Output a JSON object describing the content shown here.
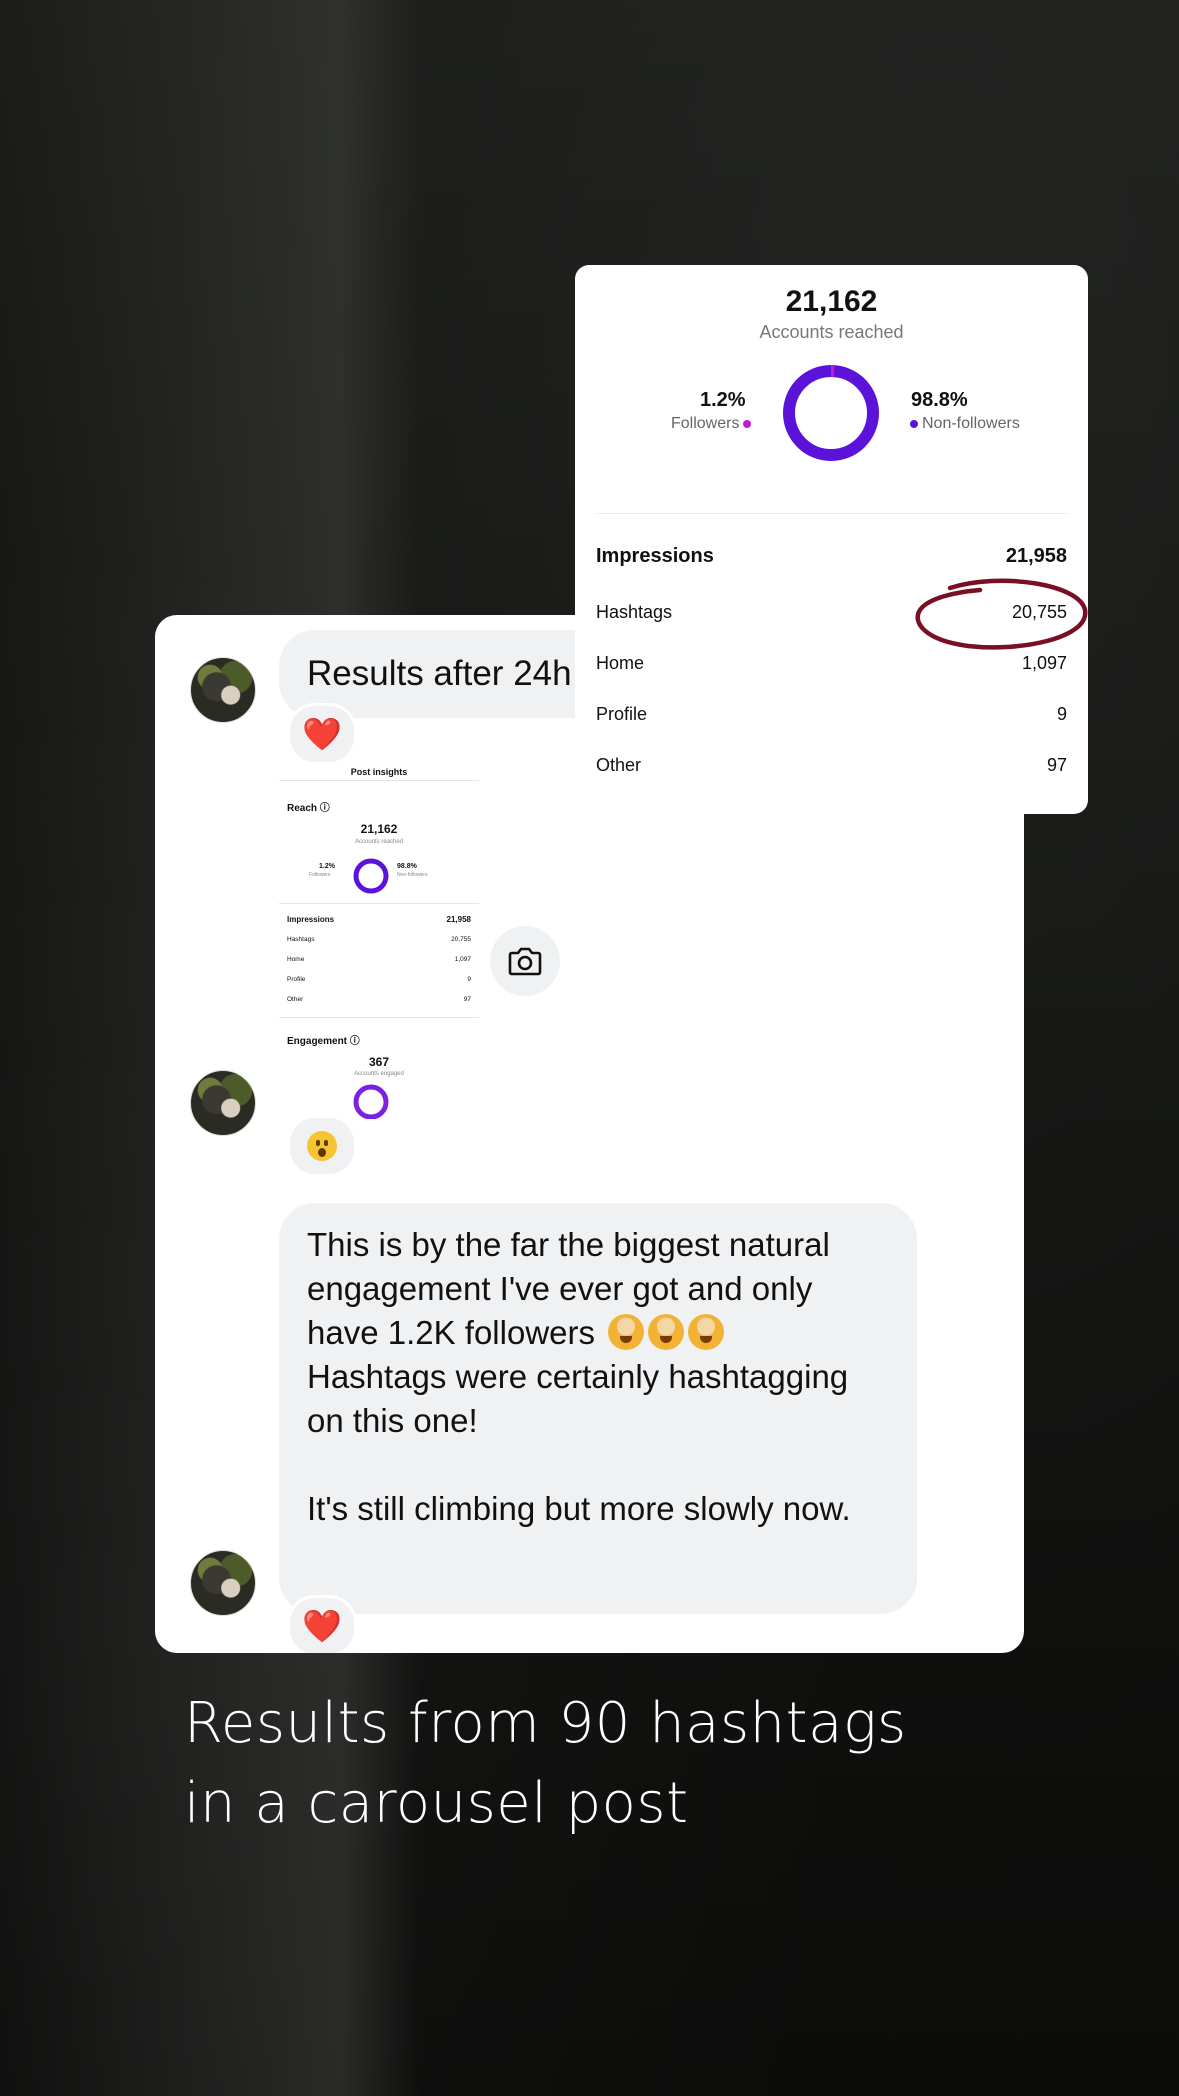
{
  "chat": {
    "message_1": "Results after 24h",
    "message_1_reaction": "❤️",
    "screenshot_reaction": "😮",
    "message_2": "This is by the far the biggest natural engagement I've ever got and only have 1.2K followers",
    "message_2_rest": "Hashtags were certainly hashtagging on this one!\n\nIt's still climbing but more slowly now.",
    "message_2_reaction": "❤️",
    "avatar_icon": "dog-avatar-icon",
    "camera_icon": "camera-icon"
  },
  "mini_insights": {
    "title": "Post insights",
    "reach_heading": "Reach ⓘ",
    "accounts_reached": "21,162",
    "accounts_reached_label": "Accounts reached",
    "followers_pct": "1.2%",
    "followers_label": "Followers",
    "non_followers_pct": "98.8%",
    "non_followers_label": "Non-followers",
    "rows": [
      {
        "label": "Impressions",
        "value": "21,958"
      },
      {
        "label": "Hashtags",
        "value": "20,755"
      },
      {
        "label": "Home",
        "value": "1,097"
      },
      {
        "label": "Profile",
        "value": "9"
      },
      {
        "label": "Other",
        "value": "97"
      }
    ],
    "engagement_heading": "Engagement ⓘ",
    "accounts_engaged": "367",
    "accounts_engaged_label": "Accounts engaged"
  },
  "insights": {
    "accounts_reached": "21,162",
    "accounts_reached_label": "Accounts reached",
    "followers_pct": "1.2%",
    "followers_label": "Followers",
    "non_followers_pct": "98.8%",
    "non_followers_label": "Non-followers",
    "followers_share": 0.012,
    "rows": [
      {
        "label": "Impressions",
        "value": "21,958"
      },
      {
        "label": "Hashtags",
        "value": "20,755"
      },
      {
        "label": "Home",
        "value": "1,097"
      },
      {
        "label": "Profile",
        "value": "9"
      },
      {
        "label": "Other",
        "value": "97"
      }
    ]
  },
  "caption": {
    "line_1": "Results from 90 hashtags",
    "line_2": "in a carousel post"
  },
  "colors": {
    "donut_purple": "#5b12d9",
    "followers_pink": "#c31ad1",
    "highlight_circle": "#7a0f23"
  }
}
